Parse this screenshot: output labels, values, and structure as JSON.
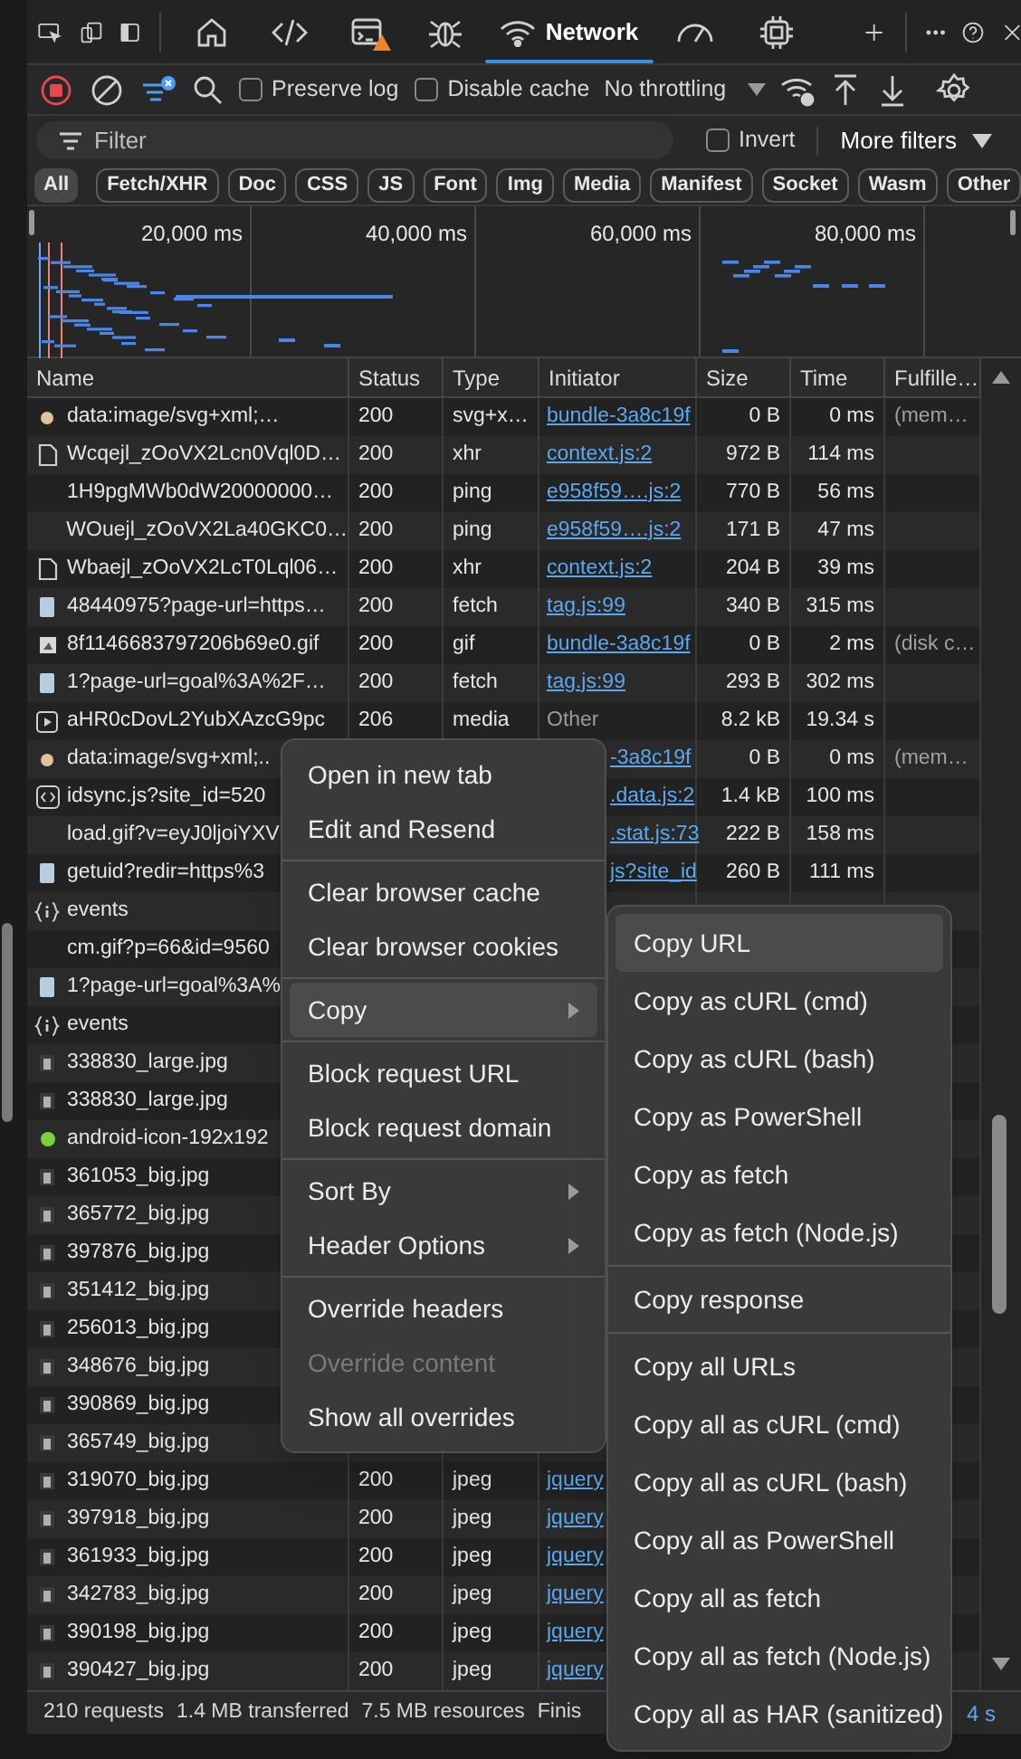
{
  "tabs": [
    {
      "selected": false,
      "warning": false
    },
    {
      "selected": false,
      "warning": false
    },
    {
      "selected": false,
      "warning": true
    },
    {
      "selected": false,
      "warning": false
    },
    {
      "label": "Network",
      "selected": true,
      "warning": false
    },
    {
      "selected": false,
      "warning": false
    },
    {
      "selected": false,
      "warning": false
    }
  ],
  "toolbar": {
    "recording": true,
    "preserve_log": {
      "label": "Preserve log",
      "checked": false
    },
    "disable_cache": {
      "label": "Disable cache",
      "checked": false
    },
    "throttling": "No throttling"
  },
  "filter": {
    "placeholder": "Filter",
    "invert": {
      "label": "Invert",
      "checked": false
    },
    "more_filters": "More filters"
  },
  "type_filters": [
    {
      "label": "All",
      "selected": true
    },
    {
      "label": "Fetch/XHR",
      "selected": false
    },
    {
      "label": "Doc",
      "selected": false
    },
    {
      "label": "CSS",
      "selected": false
    },
    {
      "label": "JS",
      "selected": false
    },
    {
      "label": "Font",
      "selected": false
    },
    {
      "label": "Img",
      "selected": false
    },
    {
      "label": "Media",
      "selected": false
    },
    {
      "label": "Manifest",
      "selected": false
    },
    {
      "label": "Socket",
      "selected": false
    },
    {
      "label": "Wasm",
      "selected": false
    },
    {
      "label": "Other",
      "selected": false
    }
  ],
  "overview": {
    "ticks": [
      "20,000 ms",
      "40,000 ms",
      "60,000 ms",
      "80,000 ms"
    ]
  },
  "table": {
    "columns": [
      "Name",
      "Status",
      "Type",
      "Initiator",
      "Size",
      "Time",
      "Fulfille…"
    ],
    "rows": [
      {
        "kind": "svg",
        "name": "data:image/svg+xml;…",
        "status": "200",
        "type": "svg+x…",
        "initiator": "bundle-3a8c19f",
        "link": true,
        "size": "0 B",
        "time": "0 ms",
        "fulfilled": "(mem…"
      },
      {
        "kind": "doc",
        "name": "Wcqejl_zOoVX2Lcn0Vql0D…",
        "status": "200",
        "type": "xhr",
        "initiator": "context.js:2",
        "link": true,
        "size": "972 B",
        "time": "114 ms"
      },
      {
        "kind": "none",
        "name": "1H9pgMWb0dW20000000…",
        "status": "200",
        "type": "ping",
        "initiator": "e958f59….js:2",
        "link": true,
        "size": "770 B",
        "time": "56 ms"
      },
      {
        "kind": "none",
        "name": "WOuejl_zOoVX2La40GKC0…",
        "status": "200",
        "type": "ping",
        "initiator": "e958f59….js:2",
        "link": true,
        "size": "171 B",
        "time": "47 ms"
      },
      {
        "kind": "doc",
        "name": "Wbaejl_zOoVX2LcT0Lql06…",
        "status": "200",
        "type": "xhr",
        "initiator": "context.js:2",
        "link": true,
        "size": "204 B",
        "time": "39 ms"
      },
      {
        "kind": "fetch",
        "name": "48440975?page-url=https…",
        "status": "200",
        "type": "fetch",
        "initiator": "tag.js:99",
        "link": true,
        "size": "340 B",
        "time": "315 ms"
      },
      {
        "kind": "gif",
        "name": "8f1146683797206b69e0.gif",
        "status": "200",
        "type": "gif",
        "initiator": "bundle-3a8c19f",
        "link": true,
        "size": "0 B",
        "time": "2 ms",
        "fulfilled": "(disk c…"
      },
      {
        "kind": "fetch",
        "name": "1?page-url=goal%3A%2F…",
        "status": "200",
        "type": "fetch",
        "initiator": "tag.js:99",
        "link": true,
        "size": "293 B",
        "time": "302 ms"
      },
      {
        "kind": "media",
        "name": "aHR0cDovL2YubXAzcG9pc",
        "status": "206",
        "type": "media",
        "initiator": "Other",
        "link": false,
        "size": "8.2 kB",
        "time": "19.34 s"
      },
      {
        "kind": "svg",
        "name": "data:image/svg+xml;..",
        "initiator": "-3a8c19f",
        "link": true,
        "size": "0 B",
        "time": "0 ms",
        "fulfilled": "(mem…"
      },
      {
        "kind": "script",
        "name": "idsync.js?site_id=520",
        "initiator": ".data.js:2",
        "link": true,
        "size": "1.4 kB",
        "time": "100 ms"
      },
      {
        "kind": "none",
        "name": "load.gif?v=eyJ0ljoiYXV",
        "initiator": ".stat.js:73",
        "link": true,
        "size": "222 B",
        "time": "158 ms"
      },
      {
        "kind": "fetch",
        "name": "getuid?redir=https%3",
        "initiator": "js?site_id",
        "link": true,
        "size": "260 B",
        "time": "111 ms"
      },
      {
        "kind": "events",
        "name": "events"
      },
      {
        "kind": "none",
        "name": "cm.gif?p=66&id=9560"
      },
      {
        "kind": "fetch",
        "name": "1?page-url=goal%3A%"
      },
      {
        "kind": "events",
        "name": "events"
      },
      {
        "kind": "jpg",
        "name": "338830_large.jpg"
      },
      {
        "kind": "jpg",
        "name": "338830_large.jpg"
      },
      {
        "kind": "android",
        "name": "android-icon-192x192"
      },
      {
        "kind": "jpg",
        "name": "361053_big.jpg"
      },
      {
        "kind": "jpg",
        "name": "365772_big.jpg"
      },
      {
        "kind": "jpg",
        "name": "397876_big.jpg"
      },
      {
        "kind": "jpg",
        "name": "351412_big.jpg"
      },
      {
        "kind": "jpg",
        "name": "256013_big.jpg"
      },
      {
        "kind": "jpg",
        "name": "348676_big.jpg"
      },
      {
        "kind": "jpg",
        "name": "390869_big.jpg"
      },
      {
        "kind": "jpg",
        "name": "365749_big.jpg"
      },
      {
        "kind": "jpg",
        "name": "319070_big.jpg",
        "status": "200",
        "type": "jpeg",
        "initiator": "jquery",
        "link": true
      },
      {
        "kind": "jpg",
        "name": "397918_big.jpg",
        "status": "200",
        "type": "jpeg",
        "initiator": "jquery",
        "link": true
      },
      {
        "kind": "jpg",
        "name": "361933_big.jpg",
        "status": "200",
        "type": "jpeg",
        "initiator": "jquery",
        "link": true
      },
      {
        "kind": "jpg",
        "name": "342783_big.jpg",
        "status": "200",
        "type": "jpeg",
        "initiator": "jquery",
        "link": true
      },
      {
        "kind": "jpg",
        "name": "390198_big.jpg",
        "status": "200",
        "type": "jpeg",
        "initiator": "jquery",
        "link": true
      },
      {
        "kind": "jpg",
        "name": "390427_big.jpg",
        "status": "200",
        "type": "jpeg",
        "initiator": "jquery",
        "link": true
      }
    ]
  },
  "context_menu": {
    "groups": [
      [
        {
          "label": "Open in new tab",
          "selected": false,
          "disabled": false,
          "submenu": false
        },
        {
          "label": "Edit and Resend",
          "selected": false,
          "disabled": false,
          "submenu": false
        }
      ],
      [
        {
          "label": "Clear browser cache",
          "selected": false,
          "disabled": false,
          "submenu": false
        },
        {
          "label": "Clear browser cookies",
          "selected": false,
          "disabled": false,
          "submenu": false
        }
      ],
      [
        {
          "label": "Copy",
          "selected": true,
          "disabled": false,
          "submenu": true
        }
      ],
      [
        {
          "label": "Block request URL",
          "selected": false,
          "disabled": false,
          "submenu": false
        },
        {
          "label": "Block request domain",
          "selected": false,
          "disabled": false,
          "submenu": false
        }
      ],
      [
        {
          "label": "Sort By",
          "selected": false,
          "disabled": false,
          "submenu": true
        },
        {
          "label": "Header Options",
          "selected": false,
          "disabled": false,
          "submenu": true
        }
      ],
      [
        {
          "label": "Override headers",
          "selected": false,
          "disabled": false,
          "submenu": false
        },
        {
          "label": "Override content",
          "selected": false,
          "disabled": true,
          "submenu": false
        },
        {
          "label": "Show all overrides",
          "selected": false,
          "disabled": false,
          "submenu": false
        }
      ]
    ]
  },
  "copy_submenu": {
    "groups": [
      [
        {
          "label": "Copy URL",
          "selected": true
        },
        {
          "label": "Copy as cURL (cmd)",
          "selected": false
        },
        {
          "label": "Copy as cURL (bash)",
          "selected": false
        },
        {
          "label": "Copy as PowerShell",
          "selected": false
        },
        {
          "label": "Copy as fetch",
          "selected": false
        },
        {
          "label": "Copy as fetch (Node.js)",
          "selected": false
        }
      ],
      [
        {
          "label": "Copy response",
          "selected": false
        }
      ],
      [
        {
          "label": "Copy all URLs",
          "selected": false
        },
        {
          "label": "Copy all as cURL (cmd)",
          "selected": false
        },
        {
          "label": "Copy all as cURL (bash)",
          "selected": false
        },
        {
          "label": "Copy all as PowerShell",
          "selected": false
        },
        {
          "label": "Copy all as fetch",
          "selected": false
        },
        {
          "label": "Copy all as fetch (Node.js)",
          "selected": false
        },
        {
          "label": "Copy all as HAR (sanitized)",
          "selected": false
        }
      ]
    ]
  },
  "status_bar": {
    "requests": "210 requests",
    "transferred": "1.4 MB transferred",
    "resources": "7.5 MB resources",
    "finish": "Finis",
    "load": "4 s"
  }
}
